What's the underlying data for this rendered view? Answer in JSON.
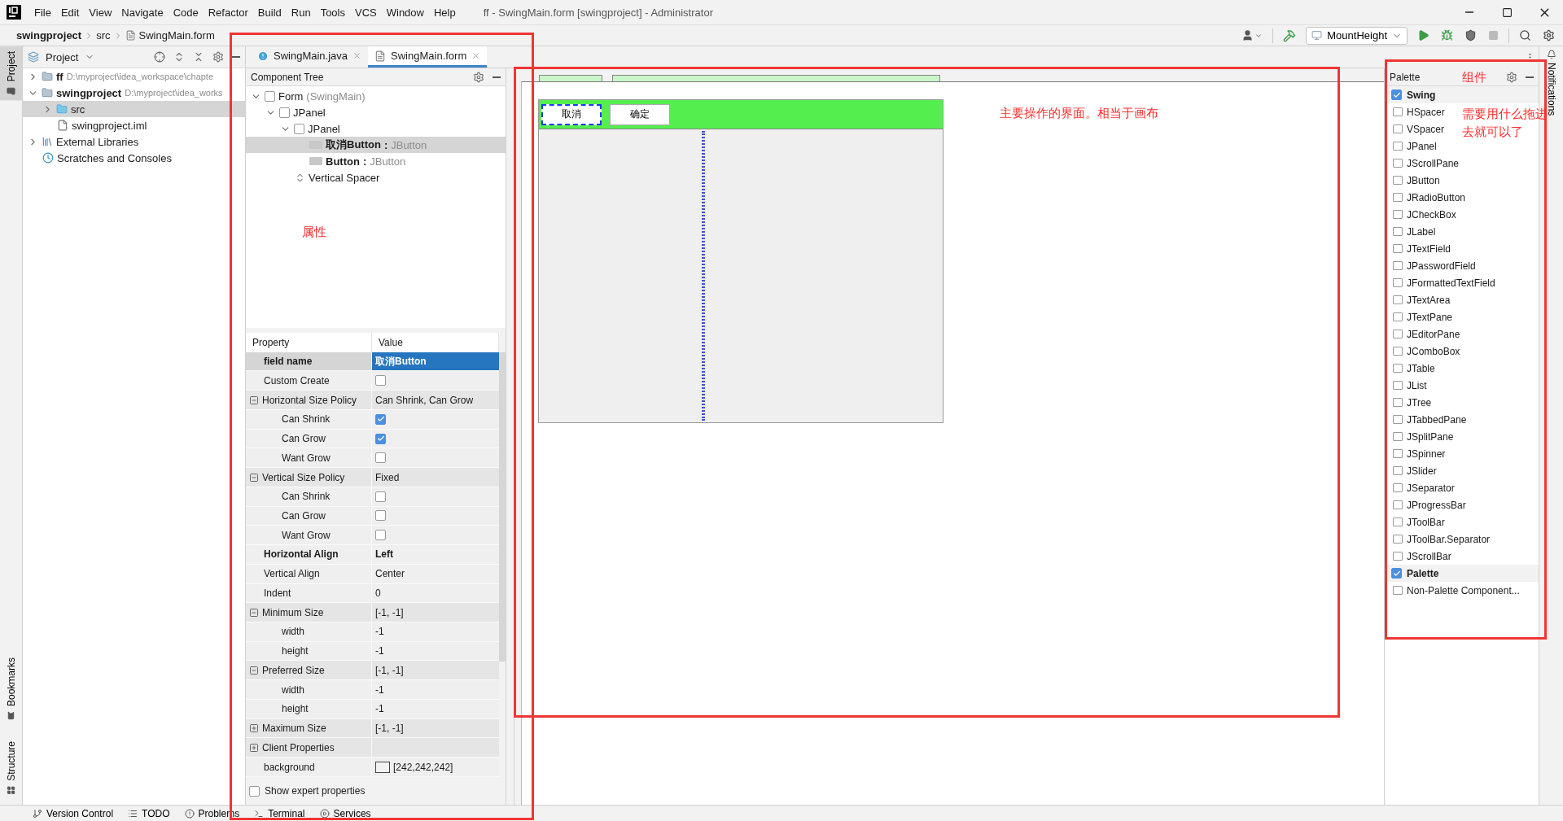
{
  "window": {
    "title": "ff - SwingMain.form [swingproject] - Administrator"
  },
  "menu": [
    "File",
    "Edit",
    "View",
    "Navigate",
    "Code",
    "Refactor",
    "Build",
    "Run",
    "Tools",
    "VCS",
    "Window",
    "Help"
  ],
  "breadcrumb": [
    {
      "label": "swingproject",
      "kind": "project"
    },
    {
      "label": "src",
      "kind": "folder"
    },
    {
      "label": "SwingMain.form",
      "kind": "file"
    }
  ],
  "run_config": "MountHeight",
  "left_tabs": {
    "top": [
      {
        "label": "Project",
        "selected": true
      }
    ],
    "bottom": [
      {
        "label": "Bookmarks",
        "selected": false
      },
      {
        "label": "Structure",
        "selected": false
      }
    ]
  },
  "project_panel": {
    "title": "Project",
    "tree": [
      {
        "name": "ff",
        "path": "D:\\myproject\\idea_workspace\\chapte",
        "kind": "module",
        "expanded": false,
        "selected": false
      },
      {
        "name": "swingproject",
        "path": "D:\\myproject\\idea_works",
        "kind": "module",
        "expanded": true,
        "selected": false,
        "children": [
          {
            "name": "src",
            "kind": "folder",
            "expanded": false,
            "selected": true
          },
          {
            "name": "swingproject.iml",
            "kind": "file",
            "selected": false
          }
        ]
      },
      {
        "name": "External Libraries",
        "kind": "libraries",
        "expanded": false,
        "selected": false
      },
      {
        "name": "Scratches and Consoles",
        "kind": "scratches",
        "selected": false
      }
    ]
  },
  "editor_tabs": [
    {
      "label": "SwingMain.java",
      "kind": "java",
      "selected": false
    },
    {
      "label": "SwingMain.form",
      "kind": "form",
      "selected": true
    }
  ],
  "component_tree": {
    "title": "Component Tree",
    "nodes": [
      {
        "name": "Form",
        "type": "(SwingMain)",
        "kind": "container",
        "expanded": true,
        "selected": false,
        "children": [
          {
            "name": "JPanel",
            "kind": "container",
            "expanded": true,
            "selected": false,
            "children": [
              {
                "name": "JPanel",
                "kind": "container",
                "expanded": true,
                "selected": false,
                "children": [
                  {
                    "name": "取消Button",
                    "separator": ":",
                    "type": "JButton",
                    "kind": "button",
                    "selected": true
                  },
                  {
                    "name": "Button",
                    "separator": ":",
                    "type": "JButton",
                    "kind": "button",
                    "selected": false
                  }
                ]
              },
              {
                "name": "Vertical Spacer",
                "kind": "spacer",
                "selected": false
              }
            ]
          }
        ]
      }
    ]
  },
  "properties": {
    "columns": [
      "Property",
      "Value"
    ],
    "rows": [
      {
        "name": "field name",
        "kind": "text",
        "value": "取消Button",
        "bold": true,
        "selected": true
      },
      {
        "name": "Custom Create",
        "kind": "checkbox",
        "checked": false,
        "bold": false,
        "selected": false
      },
      {
        "name": "Horizontal Size Policy",
        "kind": "group",
        "value": "Can Shrink, Can Grow",
        "expanded": true,
        "bold": false,
        "selected": false,
        "children": [
          {
            "name": "Can Shrink",
            "kind": "checkbox",
            "checked": true,
            "bold": false,
            "selected": false
          },
          {
            "name": "Can Grow",
            "kind": "checkbox",
            "checked": true,
            "bold": false,
            "selected": false
          },
          {
            "name": "Want Grow",
            "kind": "checkbox",
            "checked": false,
            "bold": false,
            "selected": false
          }
        ]
      },
      {
        "name": "Vertical Size Policy",
        "kind": "group",
        "value": "Fixed",
        "expanded": true,
        "bold": false,
        "selected": false,
        "children": [
          {
            "name": "Can Shrink",
            "kind": "checkbox",
            "checked": false,
            "bold": false,
            "selected": false
          },
          {
            "name": "Can Grow",
            "kind": "checkbox",
            "checked": false,
            "bold": false,
            "selected": false
          },
          {
            "name": "Want Grow",
            "kind": "checkbox",
            "checked": false,
            "bold": false,
            "selected": false
          }
        ]
      },
      {
        "name": "Horizontal Align",
        "kind": "text",
        "value": "Left",
        "bold": true,
        "selected": false
      },
      {
        "name": "Vertical Align",
        "kind": "text",
        "value": "Center",
        "bold": false,
        "selected": false
      },
      {
        "name": "Indent",
        "kind": "text",
        "value": "0",
        "bold": false,
        "selected": false
      },
      {
        "name": "Minimum Size",
        "kind": "group",
        "value": "[-1, -1]",
        "expanded": true,
        "bold": false,
        "selected": false,
        "children": [
          {
            "name": "width",
            "kind": "text",
            "value": "-1",
            "bold": false,
            "selected": false
          },
          {
            "name": "height",
            "kind": "text",
            "value": "-1",
            "bold": false,
            "selected": false
          }
        ]
      },
      {
        "name": "Preferred Size",
        "kind": "group",
        "value": "[-1, -1]",
        "expanded": true,
        "bold": false,
        "selected": false,
        "children": [
          {
            "name": "width",
            "kind": "text",
            "value": "-1",
            "bold": false,
            "selected": false
          },
          {
            "name": "height",
            "kind": "text",
            "value": "-1",
            "bold": false,
            "selected": false
          }
        ]
      },
      {
        "name": "Maximum Size",
        "kind": "group",
        "value": "[-1, -1]",
        "expanded": false,
        "bold": false,
        "selected": false
      },
      {
        "name": "Client Properties",
        "kind": "group",
        "expanded": false,
        "bold": false,
        "selected": false
      },
      {
        "name": "background",
        "kind": "color",
        "color": "#f2f2f2",
        "value": "[242,242,242]",
        "bold": false,
        "selected": false
      }
    ]
  },
  "show_expert": {
    "label": "Show expert properties",
    "checked": false
  },
  "form_canvas": {
    "buttons": [
      {
        "label": "取消",
        "selected": true
      },
      {
        "label": "确定",
        "selected": false
      }
    ]
  },
  "palette": {
    "title": "Palette",
    "groups": [
      {
        "name": "Swing",
        "checked": true,
        "items": [
          "HSpacer",
          "VSpacer",
          "JPanel",
          "JScrollPane",
          "JButton",
          "JRadioButton",
          "JCheckBox",
          "JLabel",
          "JTextField",
          "JPasswordField",
          "JFormattedTextField",
          "JTextArea",
          "JTextPane",
          "JEditorPane",
          "JComboBox",
          "JTable",
          "JList",
          "JTree",
          "JTabbedPane",
          "JSplitPane",
          "JSpinner",
          "JSlider",
          "JSeparator",
          "JProgressBar",
          "JToolBar",
          "JToolBar.Separator",
          "JScrollBar"
        ]
      },
      {
        "name": "Palette",
        "checked": true,
        "items": [
          "Non-Palette Component..."
        ]
      }
    ]
  },
  "notifications": "Notifications",
  "bottom_tools": [
    {
      "label": "Version Control",
      "kind": "vcs"
    },
    {
      "label": "TODO",
      "kind": "todo"
    },
    {
      "label": "Problems",
      "kind": "problems"
    },
    {
      "label": "Terminal",
      "kind": "terminal"
    },
    {
      "label": "Services",
      "kind": "services"
    }
  ],
  "annotations": [
    "属性",
    "主要操作的界面。相当于画布",
    "组件",
    "需要用什么拖进",
    "去就可以了"
  ]
}
